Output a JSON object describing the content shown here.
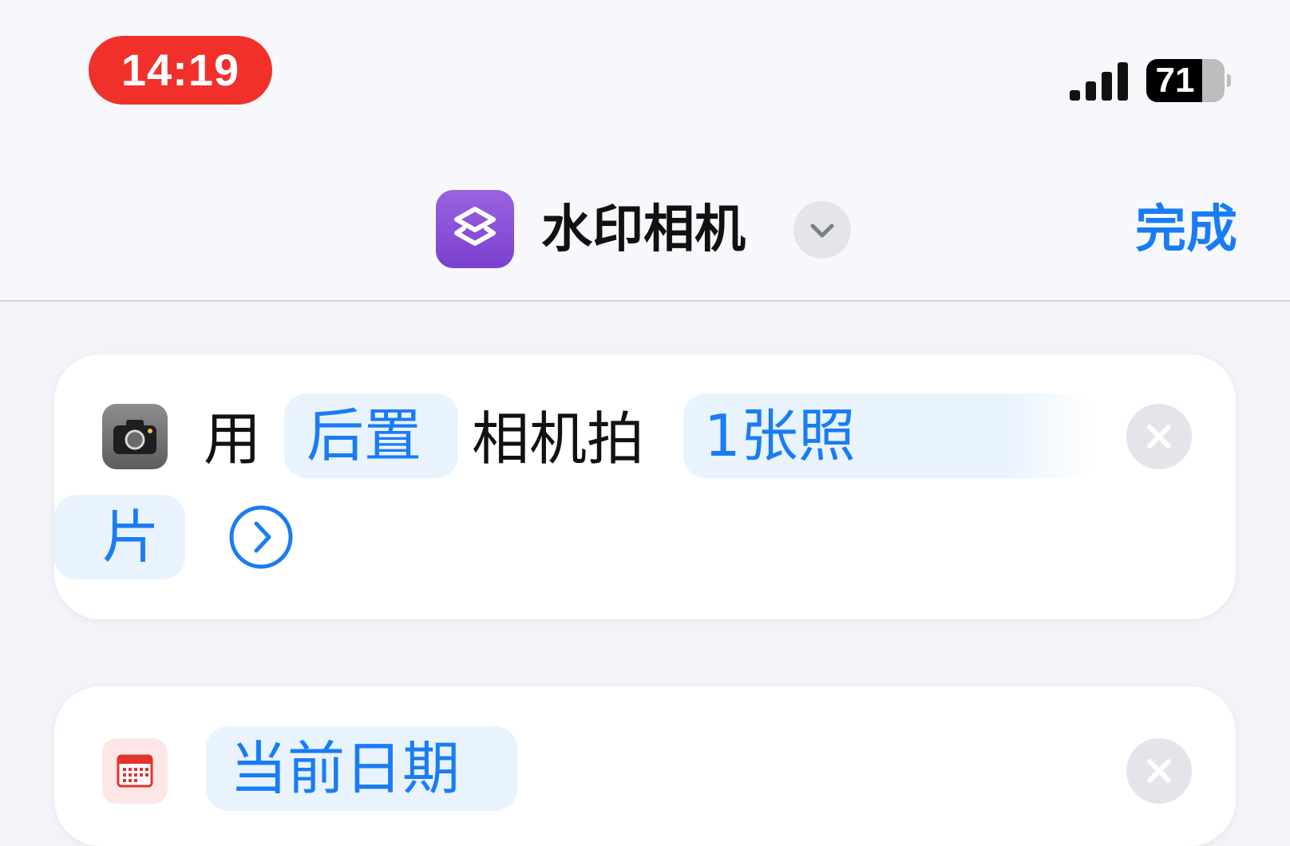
{
  "status_bar": {
    "time": "14:19",
    "battery_percent": "71",
    "battery_level": 0.71,
    "signal_bars": 4,
    "signal_icon": "cellular-signal-icon",
    "battery_icon": "battery-icon"
  },
  "nav": {
    "title": "水印相机",
    "done_label": "完成",
    "app_icon": "shortcuts-layers-icon",
    "chevron_icon": "chevron-down-icon",
    "accent_color": "#1a7cf5"
  },
  "actions": [
    {
      "icon": "camera-icon",
      "words": {
        "use": "用",
        "camera_token": "后置",
        "take": "相机拍",
        "count_token_line1": "1张照",
        "count_token_line2": "片"
      },
      "expand_icon": "chevron-right-circle-icon",
      "remove_icon": "close-icon"
    },
    {
      "icon": "calendar-icon",
      "words": {
        "date_token": "当前日期"
      },
      "remove_icon": "close-icon"
    }
  ]
}
